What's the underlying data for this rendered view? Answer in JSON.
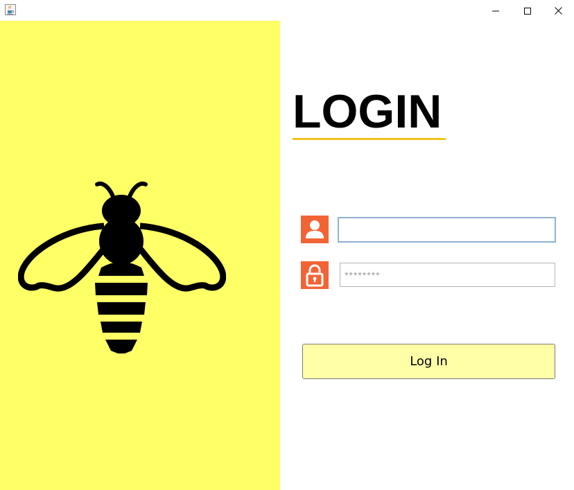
{
  "window": {
    "app_icon": "java-cup-icon",
    "controls": {
      "minimize_icon": "minimize-icon",
      "maximize_icon": "maximize-icon",
      "close_icon": "close-icon"
    }
  },
  "left_panel": {
    "background": "#ffff66",
    "illustration": "bee-logo"
  },
  "login": {
    "title": "LOGIN",
    "underline_color": "#f2c21b",
    "accent_color": "#f26435",
    "username": {
      "icon": "user-icon",
      "value": "",
      "placeholder": ""
    },
    "password": {
      "icon": "lock-icon",
      "value": "",
      "placeholder": "********"
    },
    "submit_label": "Log In",
    "button_color": "#ffffa8"
  }
}
